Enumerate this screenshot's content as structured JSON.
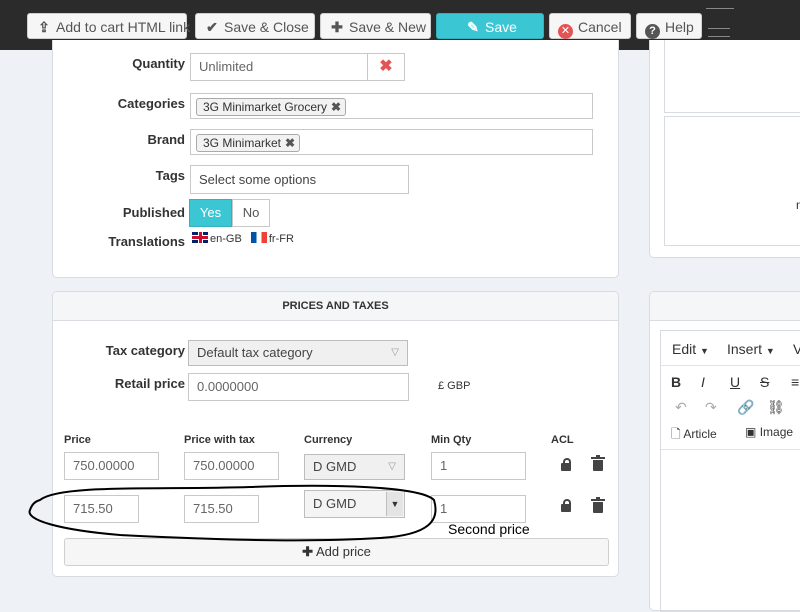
{
  "toolbar": {
    "add_to_cart": "Add to cart HTML link",
    "save_close": "Save & Close",
    "save_new": "Save & New",
    "save": "Save",
    "cancel": "Cancel",
    "help": "Help"
  },
  "form": {
    "quantity": {
      "label": "Quantity",
      "value": "Unlimited"
    },
    "categories": {
      "label": "Categories",
      "chips": [
        "3G Minimarket Grocery"
      ]
    },
    "brand": {
      "label": "Brand",
      "chips": [
        "3G Minimarket"
      ]
    },
    "tags": {
      "label": "Tags",
      "placeholder": "Select some options"
    },
    "published": {
      "label": "Published",
      "yes": "Yes",
      "no": "No",
      "selected": "Yes"
    },
    "translations": {
      "label": "Translations",
      "items": [
        "en-GB",
        "fr-FR"
      ]
    }
  },
  "prices": {
    "title": "PRICES AND TAXES",
    "tax_category": {
      "label": "Tax category",
      "value": "Default tax category"
    },
    "retail_price": {
      "label": "Retail price",
      "value": "0.0000000",
      "currency": "£ GBP"
    },
    "columns": [
      "Price",
      "Price with tax",
      "Currency",
      "Min Qty",
      "ACL"
    ],
    "rows": [
      {
        "price": "750.00000",
        "price_tax": "750.00000",
        "currency": "D GMD",
        "min_qty": "1"
      },
      {
        "price": "715.50",
        "price_tax": "715.50",
        "currency": "D GMD",
        "min_qty": "1"
      }
    ],
    "annotation": "Second price",
    "add_price": "Add price"
  },
  "editor": {
    "menu": [
      "Edit",
      "Insert"
    ],
    "format": [
      "B",
      "I",
      "U",
      "S"
    ],
    "article": "Article",
    "image": "Image"
  },
  "colors": {
    "accent": "#3bc6d3",
    "cancel": "#e25555",
    "annotation": "#000000"
  }
}
